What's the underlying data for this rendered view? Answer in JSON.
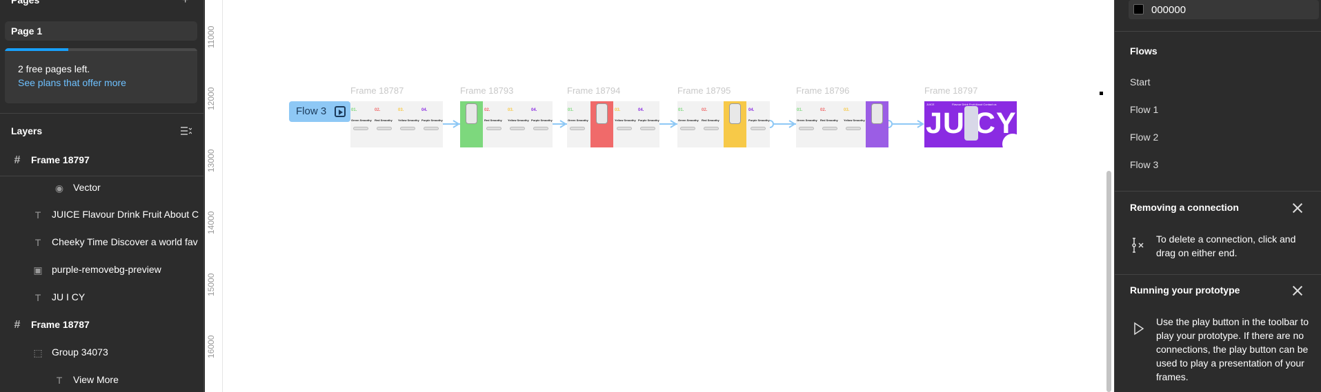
{
  "left_panel": {
    "pages_header": "Pages",
    "pages_add_icon": "plus-icon",
    "current_page": "Page 1",
    "free_pages_progress": 0.33,
    "free_pages_text": "2 free pages left.",
    "free_pages_link": "See plans that offer more",
    "layers_title": "Layers",
    "layers": [
      {
        "label": "Frame 18797",
        "icon": "frame-icon",
        "bold": true
      },
      {
        "label": "Vector",
        "icon": "vector-icon",
        "bold": false
      },
      {
        "label": "JUICE Flavour Drink Fruit About C",
        "icon": "text-icon",
        "bold": false
      },
      {
        "label": "Cheeky Time Discover a world fav",
        "icon": "text-icon",
        "bold": false
      },
      {
        "label": "purple-removebg-preview",
        "icon": "image-icon",
        "bold": false
      },
      {
        "label": "JU I CY",
        "icon": "text-icon",
        "bold": false
      },
      {
        "label": "Frame 18787",
        "icon": "frame-icon",
        "bold": true
      },
      {
        "label": "Group 34073",
        "icon": "group-icon",
        "bold": false
      },
      {
        "label": "View More",
        "icon": "text-icon",
        "bold": false
      }
    ]
  },
  "ruler": {
    "ticks": [
      "11000",
      "12000",
      "13000",
      "14000",
      "15000",
      "16000"
    ]
  },
  "canvas": {
    "flow_badge": "Flow 3",
    "frames": [
      {
        "label": "Frame 18787",
        "accent": "#f2f2f2"
      },
      {
        "label": "Frame 18793",
        "accent": "#7dd87d"
      },
      {
        "label": "Frame 18794",
        "accent": "#f06a6a"
      },
      {
        "label": "Frame 18795",
        "accent": "#f7c948"
      },
      {
        "label": "Frame 18796",
        "accent": "#9b5de5"
      },
      {
        "label": "Frame 18797",
        "accent": "#8a2be2"
      }
    ],
    "mini": {
      "nums": [
        "01.",
        "02.",
        "03.",
        "04."
      ],
      "num_colors": [
        "#7dd87d",
        "#f06a6a",
        "#f7c948",
        "#8a2be2"
      ],
      "names": [
        "Green Smoothy",
        "Red Smoothy",
        "Yellow Smoothy",
        "Purple Smoothy"
      ],
      "button": "View More"
    },
    "juicy_title": "JU  CY",
    "juicy_brand": "JUICE",
    "juicy_nav": "Flavour  Drink  Fruit  About  Contact us"
  },
  "right_panel": {
    "color_hex": "000000",
    "color_value": "#000000",
    "flows_title": "Flows",
    "flows": [
      "Start",
      "Flow 1",
      "Flow 2",
      "Flow 3"
    ],
    "removing_title": "Removing a connection",
    "removing_text": "To delete a connection, click and drag on either end.",
    "running_title": "Running your prototype",
    "running_text": "Use the play button in the toolbar to play your prototype. If there are no connections, the play button can be used to play a presentation of your frames."
  },
  "colors": {
    "accent_blue": "#18a0fb",
    "link_blue": "#6ec1ff",
    "flow_blue": "#8ec8f5"
  }
}
